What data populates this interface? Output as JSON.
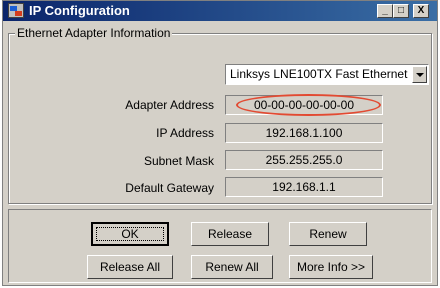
{
  "window": {
    "title": "IP Configuration",
    "controls": {
      "minimize": "_",
      "maximize": "□",
      "close": "X"
    }
  },
  "group": {
    "label": "Ethernet  Adapter Information",
    "adapter_select": {
      "value": "Linksys LNE100TX Fast Ethernet"
    },
    "rows": [
      {
        "label": "Adapter Address",
        "value": "00-00-00-00-00-00"
      },
      {
        "label": "IP Address",
        "value": "192.168.1.100"
      },
      {
        "label": "Subnet Mask",
        "value": "255.255.255.0"
      },
      {
        "label": "Default Gateway",
        "value": "192.168.1.1"
      }
    ],
    "highlight_color": "#e24a32"
  },
  "buttons": {
    "ok": "OK",
    "release": "Release",
    "renew": "Renew",
    "release_all": "Release All",
    "renew_all": "Renew All",
    "more_info": "More Info >>"
  },
  "colors": {
    "title_start": "#0a246a",
    "title_end": "#3a6ea5",
    "face": "#d4d0c8"
  },
  "icons": {
    "title": "network-config-icon",
    "dropdown": "chevron-down-icon"
  }
}
